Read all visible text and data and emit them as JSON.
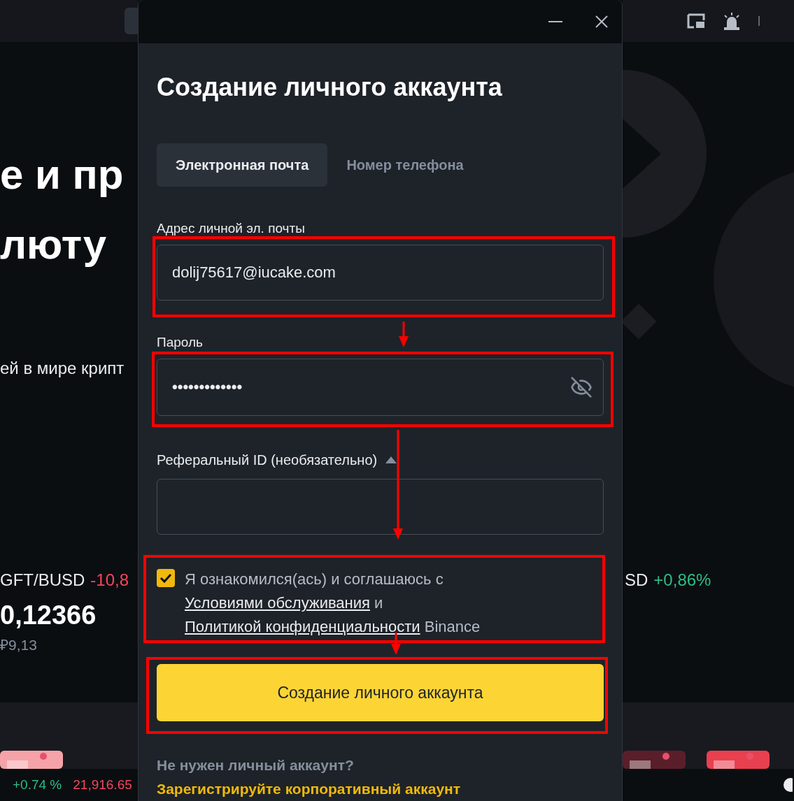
{
  "background_page": {
    "hero_lines": [
      "е и пр",
      "люту"
    ],
    "subtitle": "ей в мире крипт",
    "tickers": [
      {
        "pair": "GFT/BUSD",
        "change": "-10,8",
        "color": "#f6465d",
        "price": "0,12366",
        "fiat": "₽9,13"
      },
      {
        "pair": "SD",
        "change": "+0,86%",
        "color": "#2ebd85"
      }
    ],
    "bottom_ticker": [
      {
        "text": "+0.74 %",
        "color": "#2ebd85"
      },
      {
        "text": "21,916.65",
        "color": "#f6465d"
      }
    ]
  },
  "dialog": {
    "title": "Создание личного аккаунта",
    "tabs": [
      {
        "label": "Электронная почта",
        "selected": true
      },
      {
        "label": "Номер телефона",
        "selected": false
      }
    ],
    "email": {
      "label": "Адрес личной эл. почты",
      "value": "dolij75617@iucake.com"
    },
    "password": {
      "label": "Пароль",
      "value": "•••••••••••••",
      "masked": true
    },
    "referral": {
      "label": "Реферальный ID (необязательно)",
      "expanded": true
    },
    "agreement": {
      "checked": true,
      "parts": [
        {
          "kind": "text",
          "text": "Я ознакомился(ась) и соглашаюсь с"
        },
        {
          "kind": "link",
          "text": "Условиями обслуживания"
        },
        {
          "kind": "text",
          "text": "и"
        },
        {
          "kind": "link",
          "text": "Политикой конфиденциальности"
        },
        {
          "kind": "text",
          "text": "Binance"
        }
      ]
    },
    "submit_button": "Создание личного аккаунта",
    "footer": {
      "question": "Не нужен личный аккаунт?",
      "link": "Зарегистрируйте корпоративный аккаунт"
    }
  }
}
